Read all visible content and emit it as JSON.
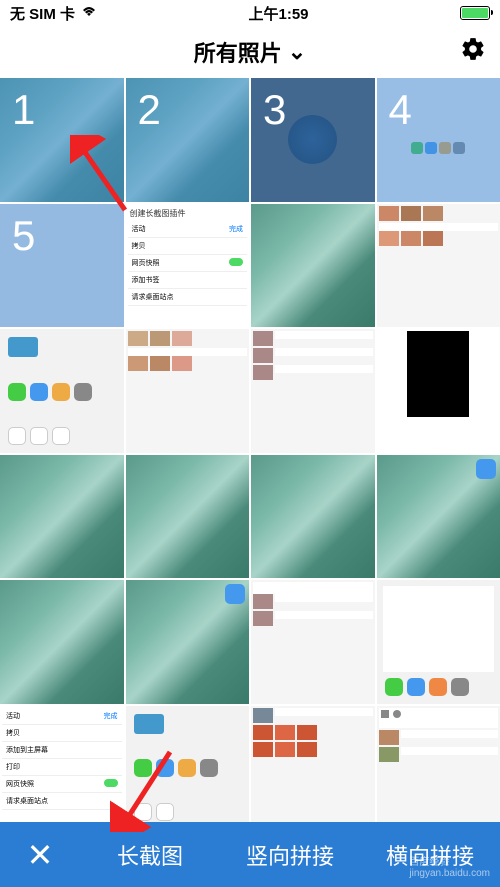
{
  "status_bar": {
    "carrier": "无 SIM 卡",
    "time": "上午1:59"
  },
  "header": {
    "title": "所有照片",
    "dropdown_indicator": "⌄"
  },
  "selected_photos": {
    "numbers": [
      "1",
      "2",
      "3",
      "4",
      "5"
    ]
  },
  "settings_items": {
    "title": "创建长截图插件",
    "action_label": "活动",
    "done_label": "完成",
    "items": [
      "拷贝",
      "网页快照",
      "添加书签",
      "请求桌面站点",
      "添加到主屏幕",
      "打印"
    ]
  },
  "bottom_bar": {
    "close": "✕",
    "long_screenshot": "长截图",
    "vertical_stitch": "竖向拼接",
    "horizontal_stitch": "横向拼接"
  },
  "watermark": {
    "text": "百度经验",
    "url": "jingyan.baidu.com"
  }
}
